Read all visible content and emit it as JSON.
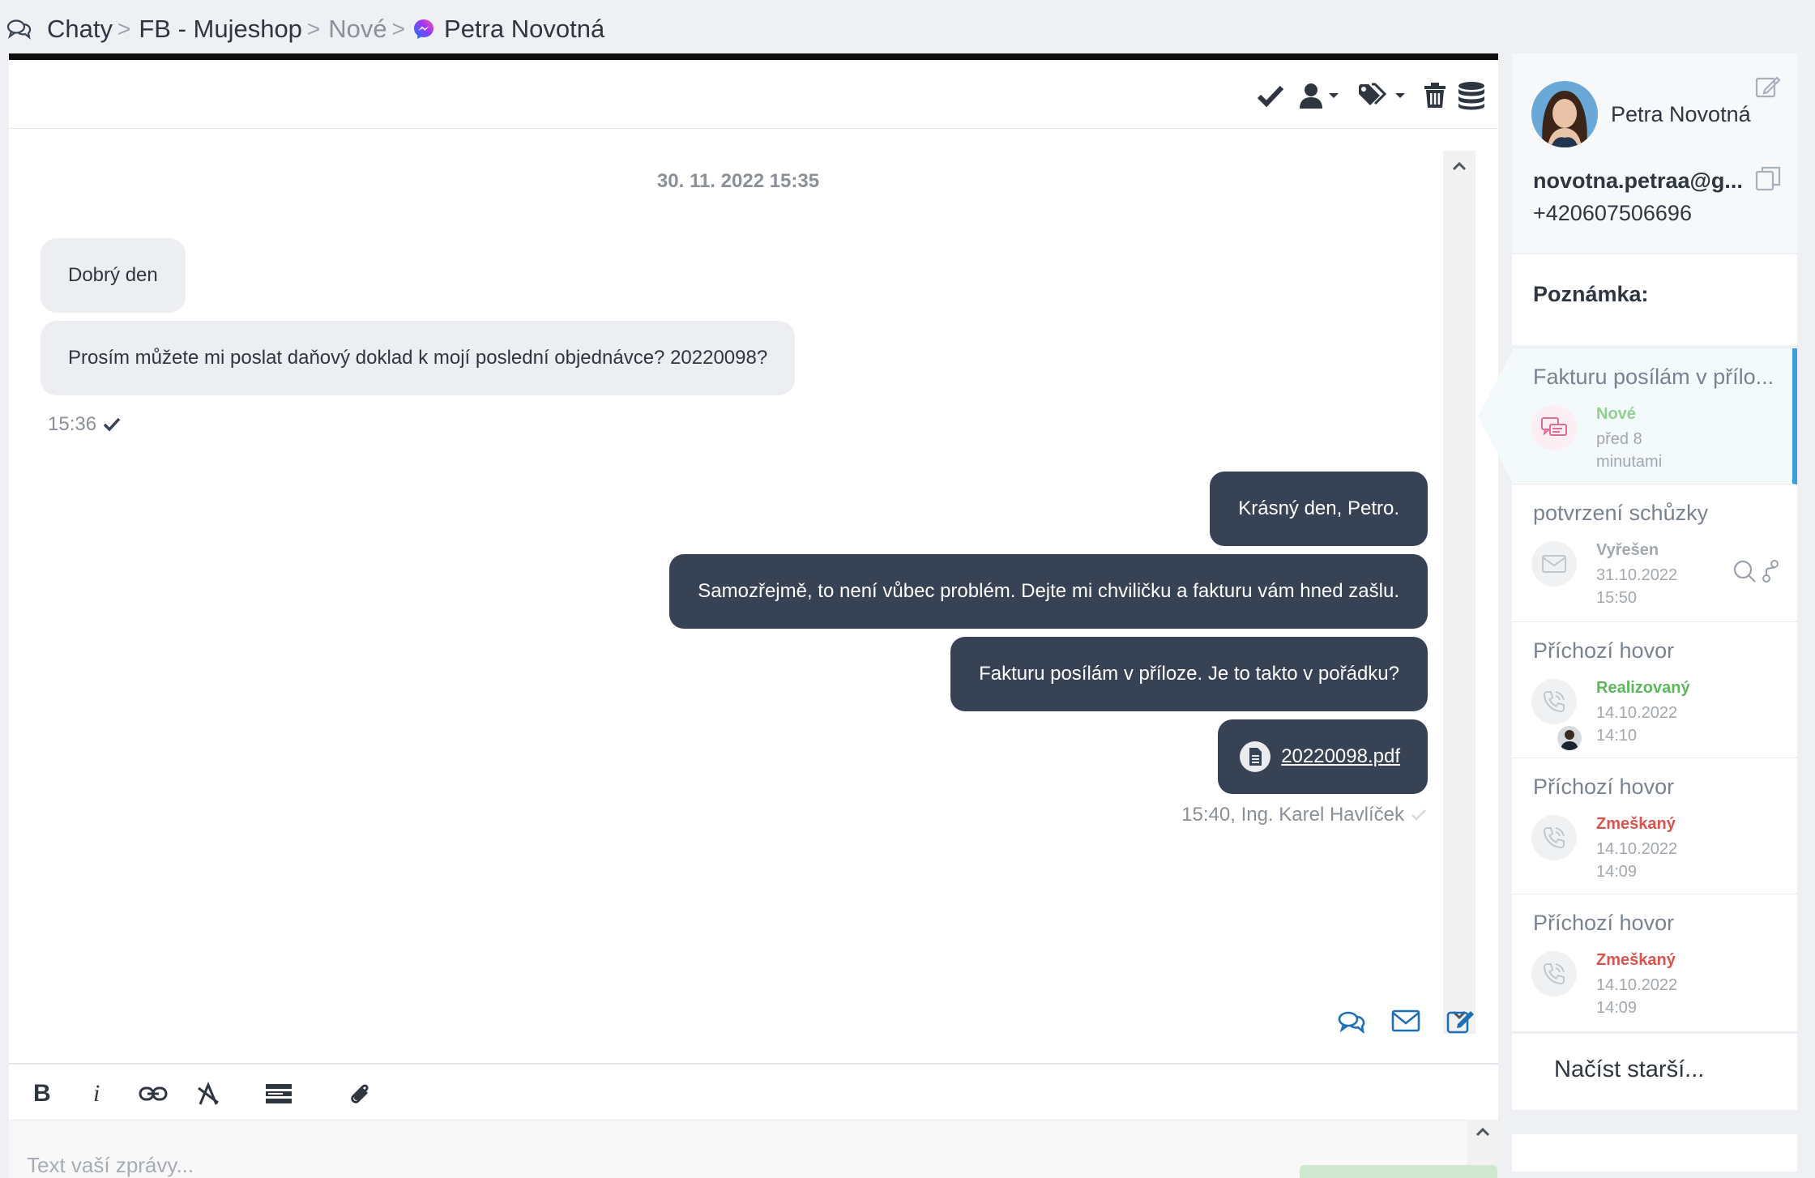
{
  "breadcrumb": {
    "items": [
      "Chaty",
      "FB - Mujeshop",
      "Nové",
      "Petra Novotná"
    ],
    "separator": ">"
  },
  "toolbar": {
    "icons": [
      "check-icon",
      "user-assign-icon",
      "tags-icon",
      "trash-icon",
      "database-icon"
    ]
  },
  "chat": {
    "date": "30. 11. 2022 15:35",
    "incoming": [
      {
        "text": "Dobrý den"
      },
      {
        "text": "Prosím můžete mi poslat daňový doklad k mojí poslední objednávce? 20220098?"
      }
    ],
    "incoming_time": "15:36",
    "outgoing": [
      {
        "text": "Krásný den, Petro."
      },
      {
        "text": "Samozřejmě, to není vůbec problém. Dejte mi chviličku a fakturu vám hned zašlu."
      },
      {
        "text": "Fakturu posílám v příloze. Je to takto v pořádku?"
      }
    ],
    "attachment": "20220098.pdf",
    "outgoing_meta": "15:40, Ing. Karel Havlíček"
  },
  "channels": [
    "chat-icon",
    "email-icon",
    "note-icon"
  ],
  "editor": {
    "tools": [
      "B",
      "i",
      "link-icon",
      "clear-format-icon",
      "template-icon",
      "attach-icon"
    ],
    "placeholder": "Text vaší zprávy..."
  },
  "contact": {
    "name": "Petra Novotná",
    "email": "novotna.petraa@g...",
    "phone": "+420607506696",
    "note_label": "Poznámka:"
  },
  "history": [
    {
      "title": "Fakturu posílám v přílo...",
      "status": "Nové",
      "time": "před 8 minutami",
      "type": "chat",
      "status_color": "#8fd18f"
    },
    {
      "title": "potvrzení schůzky",
      "status": "Vyřešen",
      "time": "31.10.2022 15:50",
      "type": "email",
      "status_color": "#a3a8b0"
    },
    {
      "title": "Příchozí hovor",
      "status": "Realizovaný",
      "time": "14.10.2022 14:10",
      "type": "call",
      "status_color": "#5cb85c"
    },
    {
      "title": "Příchozí hovor",
      "status": "Zmeškaný",
      "time": "14.10.2022 14:09",
      "type": "call",
      "status_color": "#d9534f"
    },
    {
      "title": "Příchozí hovor",
      "status": "Zmeškaný",
      "time": "14.10.2022 14:09",
      "type": "call",
      "status_color": "#d9534f"
    }
  ],
  "load_older": "Načíst starší..."
}
